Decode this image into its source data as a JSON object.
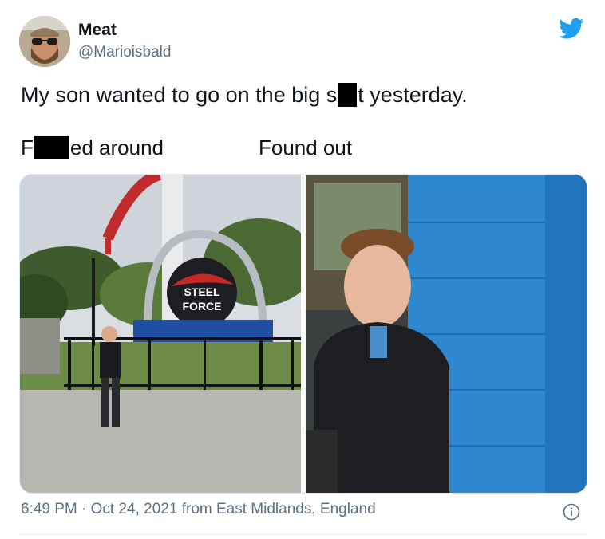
{
  "tweet": {
    "author": {
      "display_name": "Meat",
      "handle": "@Marioisbald"
    },
    "text_before": "My son wanted to go on the big s",
    "text_after": "t yesterday.",
    "captions": {
      "left_prefix": "F",
      "left_suffix": "ed around",
      "right": "Found out"
    },
    "images": {
      "left": {
        "sign_line1": "STEEL",
        "sign_line2": "FORCE"
      }
    },
    "footer": {
      "time": "6:49 PM",
      "separator": "·",
      "date": "Oct 24, 2021",
      "location": "from East Midlands, England"
    }
  },
  "colors": {
    "twitter_blue": "#1da1f2",
    "secondary_text": "#5b7083"
  },
  "icons": [
    "twitter-bird-icon",
    "info-icon"
  ]
}
